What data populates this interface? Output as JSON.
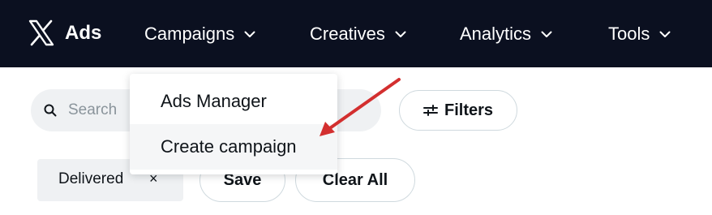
{
  "header": {
    "brand_label": "Ads",
    "nav": [
      {
        "label": "Campaigns"
      },
      {
        "label": "Creatives"
      },
      {
        "label": "Analytics"
      },
      {
        "label": "Tools"
      }
    ]
  },
  "dropdown": {
    "items": [
      {
        "label": "Ads Manager"
      },
      {
        "label": "Create campaign"
      }
    ]
  },
  "search": {
    "placeholder": "Search"
  },
  "toolbar": {
    "filters_label": "Filters"
  },
  "active_filters": {
    "chip_label": "Delivered",
    "remove_symbol": "×"
  },
  "actions": {
    "save_label": "Save",
    "clear_all_label": "Clear All"
  },
  "annotation": {
    "arrow_color": "#d32f2f"
  },
  "colors": {
    "topbar": "#0b1020",
    "text": "#0f1419",
    "chip_bg": "#eff1f3"
  },
  "icons": [
    "x-logo-icon",
    "chevron-down-icon",
    "search-icon",
    "filters-icon",
    "close-icon"
  ]
}
